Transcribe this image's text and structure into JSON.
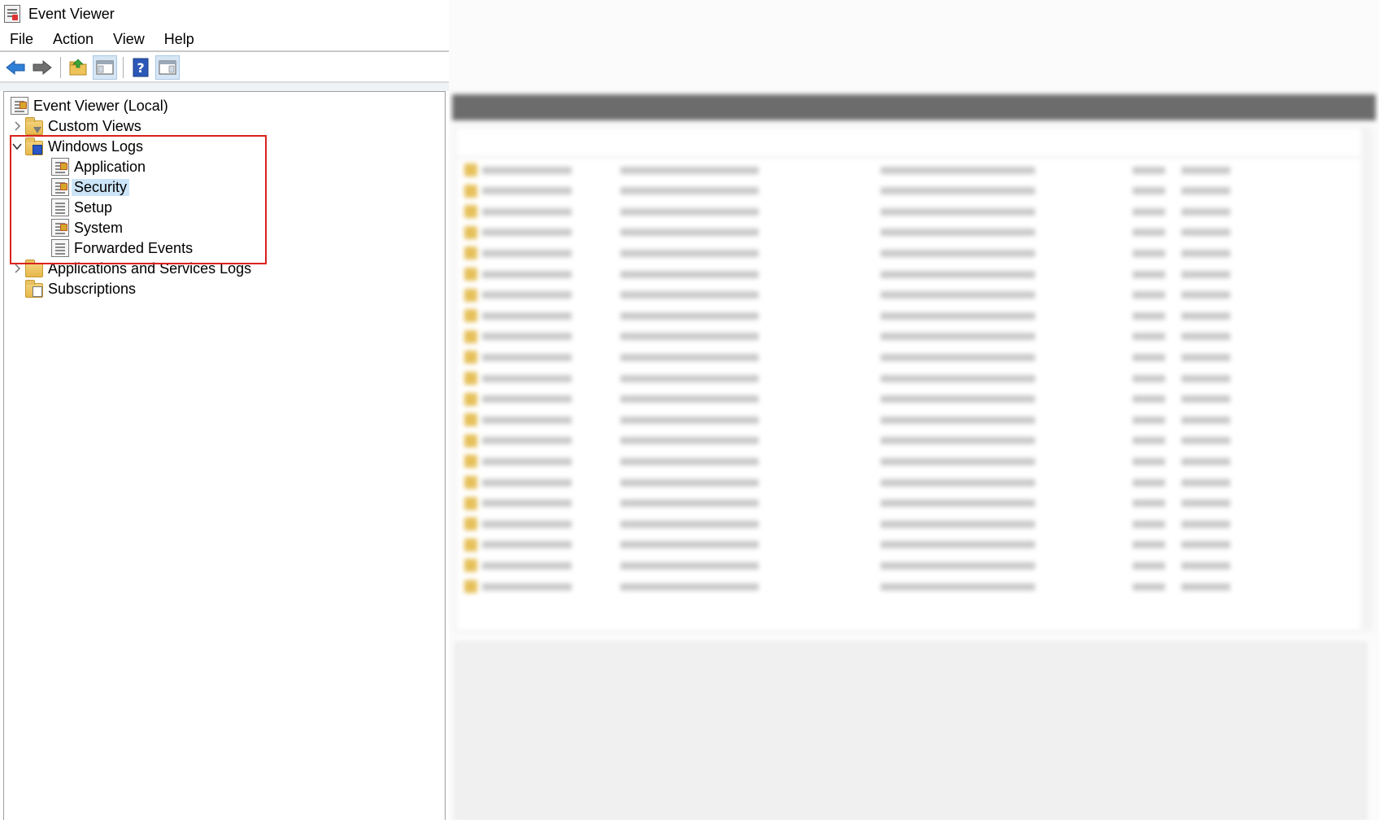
{
  "window": {
    "title": "Event Viewer",
    "icon": "event-viewer-icon"
  },
  "menu": {
    "items": [
      "File",
      "Action",
      "View",
      "Help"
    ]
  },
  "toolbar": {
    "buttons": [
      "back-arrow-icon",
      "forward-arrow-icon",
      "open-folder-icon",
      "show-hide-console-tree-icon",
      "help-icon",
      "show-hide-action-pane-icon"
    ]
  },
  "tree": {
    "root": "Event Viewer (Local)",
    "custom_views": "Custom Views",
    "windows_logs": "Windows Logs",
    "application": "Application",
    "security": "Security",
    "setup": "Setup",
    "system": "System",
    "forwarded_events": "Forwarded Events",
    "apps_services_logs": "Applications and Services Logs",
    "subscriptions": "Subscriptions",
    "selected": "Security"
  },
  "highlight": {
    "color": "#d9221c",
    "target": "Windows Logs"
  },
  "colors": {
    "selection": "#cce4f7",
    "back_arrow": "#2f7fd6"
  },
  "right_pane": {
    "blurred": true
  }
}
